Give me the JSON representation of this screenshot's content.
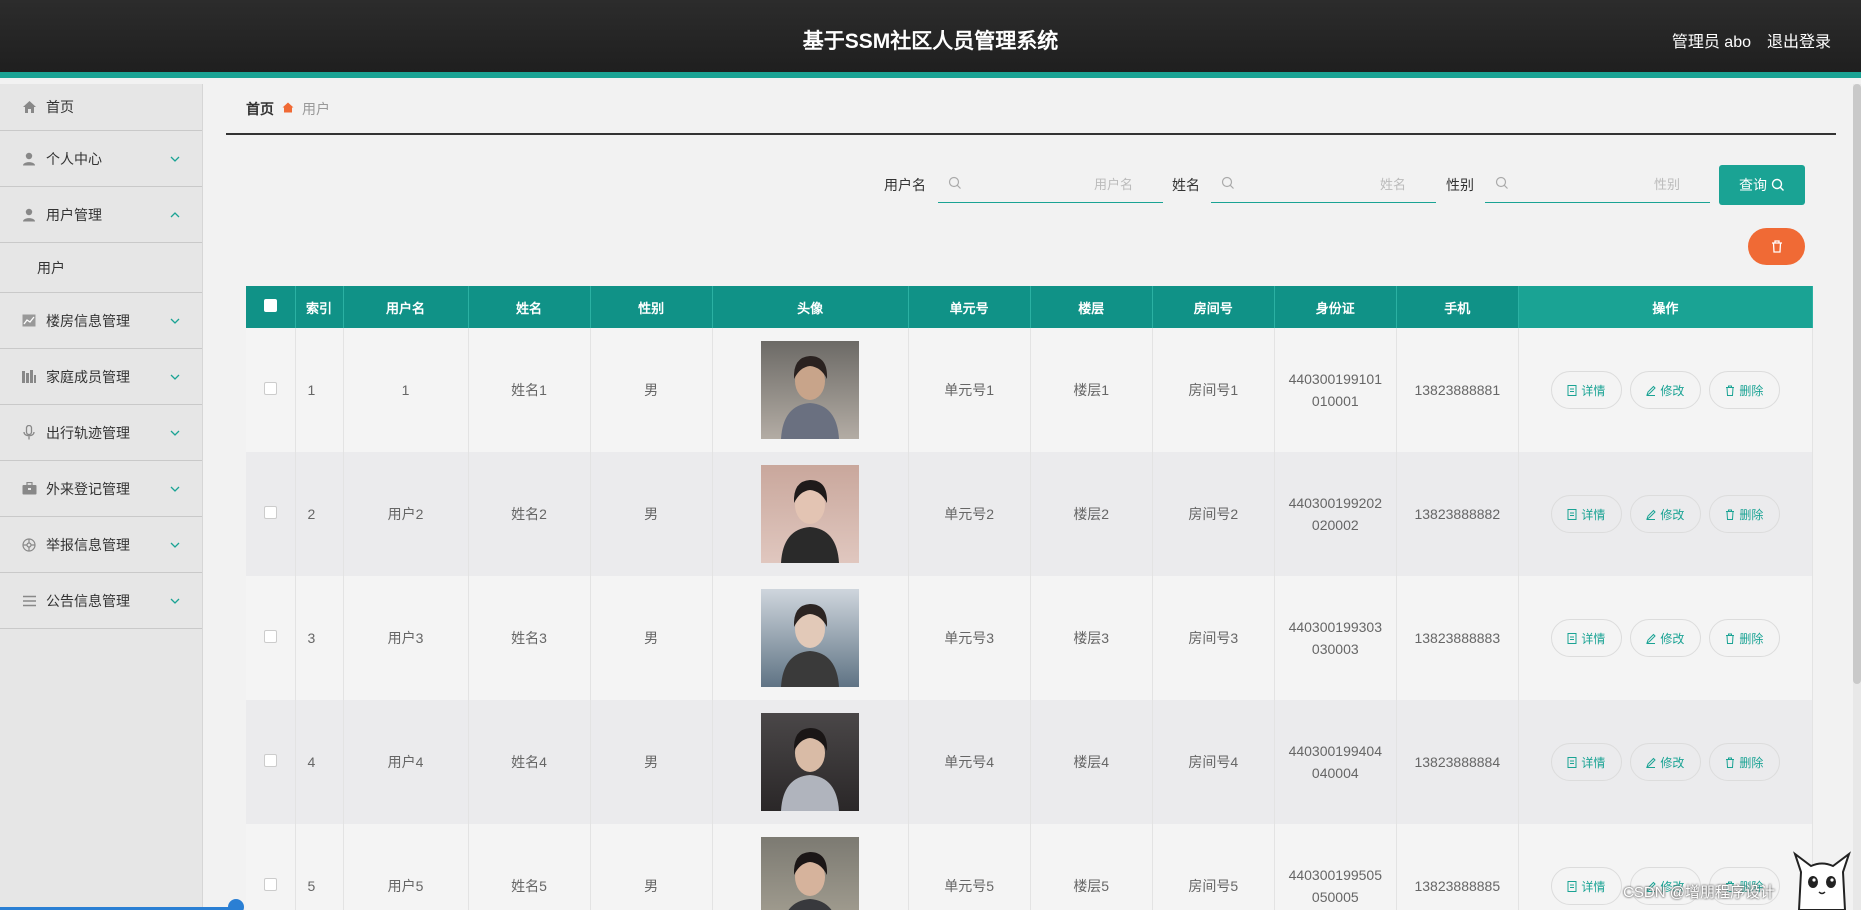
{
  "header": {
    "title": "基于SSM社区人员管理系统",
    "user": "管理员 abo",
    "logout": "退出登录"
  },
  "sidebar": {
    "items": [
      {
        "label": "首页",
        "icon": "home-icon"
      },
      {
        "label": "个人中心",
        "icon": "person-icon"
      },
      {
        "label": "用户管理",
        "icon": "person-icon",
        "expanded": true,
        "sub": [
          "用户"
        ]
      },
      {
        "label": "楼房信息管理",
        "icon": "chart-icon"
      },
      {
        "label": "家庭成员管理",
        "icon": "bars-icon"
      },
      {
        "label": "出行轨迹管理",
        "icon": "mic-icon"
      },
      {
        "label": "外来登记管理",
        "icon": "briefcase-icon"
      },
      {
        "label": "举报信息管理",
        "icon": "globe-icon"
      },
      {
        "label": "公告信息管理",
        "icon": "list-icon"
      }
    ]
  },
  "breadcrumb": {
    "home": "首页",
    "current": "用户"
  },
  "search": {
    "username_label": "用户名",
    "username_placeholder": "用户名",
    "name_label": "姓名",
    "name_placeholder": "姓名",
    "gender_label": "性别",
    "gender_placeholder": "性别",
    "query_label": "查询"
  },
  "table": {
    "columns": [
      "索引",
      "用户名",
      "姓名",
      "性别",
      "头像",
      "单元号",
      "楼层",
      "房间号",
      "身份证",
      "手机",
      "操作"
    ],
    "actions": {
      "detail": "详情",
      "edit": "修改",
      "delete": "删除"
    },
    "rows": [
      {
        "index": "1",
        "username": "1",
        "name": "姓名1",
        "gender": "男",
        "unit": "单元号1",
        "floor": "楼层1",
        "room": "房间号1",
        "id_card_1": "440300199101",
        "id_card_2": "010001",
        "phone": "13823888881"
      },
      {
        "index": "2",
        "username": "用户2",
        "name": "姓名2",
        "gender": "男",
        "unit": "单元号2",
        "floor": "楼层2",
        "room": "房间号2",
        "id_card_1": "440300199202",
        "id_card_2": "020002",
        "phone": "13823888882"
      },
      {
        "index": "3",
        "username": "用户3",
        "name": "姓名3",
        "gender": "男",
        "unit": "单元号3",
        "floor": "楼层3",
        "room": "房间号3",
        "id_card_1": "440300199303",
        "id_card_2": "030003",
        "phone": "13823888883"
      },
      {
        "index": "4",
        "username": "用户4",
        "name": "姓名4",
        "gender": "男",
        "unit": "单元号4",
        "floor": "楼层4",
        "room": "房间号4",
        "id_card_1": "440300199404",
        "id_card_2": "040004",
        "phone": "13823888884"
      },
      {
        "index": "5",
        "username": "用户5",
        "name": "姓名5",
        "gender": "男",
        "unit": "单元号5",
        "floor": "楼层5",
        "room": "房间号5",
        "id_card_1": "440300199505",
        "id_card_2": "050005",
        "phone": "13823888885"
      }
    ]
  },
  "watermark": "CSDN @增朋程序设计",
  "colors": {
    "accent": "#1aa394",
    "header_dark": "#109287",
    "orange": "#f06a35"
  }
}
